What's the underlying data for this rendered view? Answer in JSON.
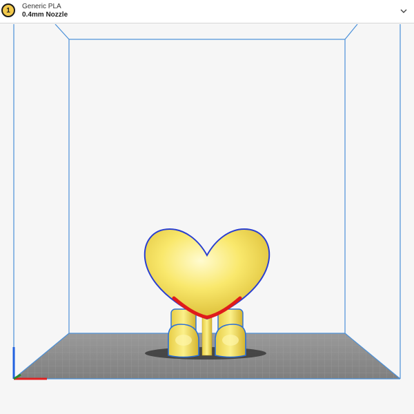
{
  "extruder": {
    "number": "1",
    "material": "Generic PLA",
    "nozzle": "0.4mm Nozzle"
  },
  "icons": {
    "dropdown": "chevron-down-icon"
  },
  "colors": {
    "build_volume_outline": "#4a90d9",
    "model": "#f7e36a",
    "model_outline": "#2a3fd1",
    "overhang_highlight": "#e01b1b",
    "build_plate": "#8c8c8c",
    "axis_x": "#e02020",
    "axis_y": "#2060e0",
    "axis_z": "#2a8a2a"
  }
}
